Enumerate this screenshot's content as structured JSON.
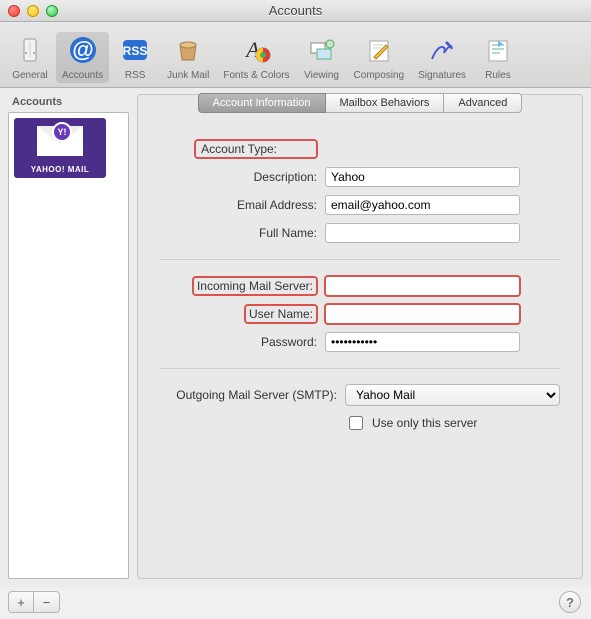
{
  "window": {
    "title": "Accounts"
  },
  "toolbar": {
    "items": [
      {
        "label": "General",
        "icon": "gear",
        "active": false
      },
      {
        "label": "Accounts",
        "icon": "at",
        "active": true
      },
      {
        "label": "RSS",
        "icon": "rss",
        "active": false
      },
      {
        "label": "Junk Mail",
        "icon": "trash",
        "active": false
      },
      {
        "label": "Fonts & Colors",
        "icon": "font-colors",
        "active": false
      },
      {
        "label": "Viewing",
        "icon": "viewing",
        "active": false
      },
      {
        "label": "Composing",
        "icon": "compose",
        "active": false
      },
      {
        "label": "Signatures",
        "icon": "signature",
        "active": false
      },
      {
        "label": "Rules",
        "icon": "rules",
        "active": false
      }
    ]
  },
  "sidebar": {
    "header": "Accounts",
    "accounts": [
      {
        "brand": "YAHOO! MAIL",
        "badge": "Y!"
      }
    ],
    "add_label": "+",
    "remove_label": "−"
  },
  "tabs": {
    "items": [
      "Account Information",
      "Mailbox Behaviors",
      "Advanced"
    ],
    "active_index": 0
  },
  "form": {
    "account_type_label": "Account Type:",
    "account_type_value": "",
    "description_label": "Description:",
    "description_value": "Yahoo",
    "email_label": "Email Address:",
    "email_value": "email@yahoo.com",
    "full_name_label": "Full Name:",
    "full_name_value": "",
    "incoming_label": "Incoming Mail Server:",
    "incoming_value": "",
    "username_label": "User Name:",
    "username_value": "",
    "password_label": "Password:",
    "password_value": "•••••••••••",
    "smtp_label": "Outgoing Mail Server (SMTP):",
    "smtp_selected": "Yahoo Mail",
    "use_only_label": "Use only this server",
    "use_only_checked": false
  },
  "help_label": "?"
}
